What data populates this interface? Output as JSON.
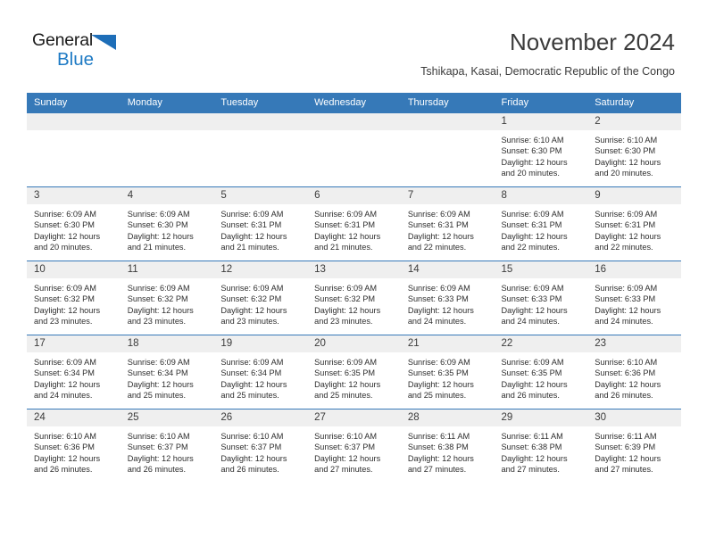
{
  "brand": {
    "name_top": "General",
    "name_bottom": "Blue",
    "accent_color": "#1e7ac4",
    "triangle_color": "#1e6eb8"
  },
  "header": {
    "title": "November 2024",
    "location": "Tshikapa, Kasai, Democratic Republic of the Congo"
  },
  "calendar": {
    "header_bg": "#3679b8",
    "daynum_bg": "#efefef",
    "weekdays": [
      "Sunday",
      "Monday",
      "Tuesday",
      "Wednesday",
      "Thursday",
      "Friday",
      "Saturday"
    ],
    "weeks": [
      [
        {
          "day": "",
          "lines": []
        },
        {
          "day": "",
          "lines": []
        },
        {
          "day": "",
          "lines": []
        },
        {
          "day": "",
          "lines": []
        },
        {
          "day": "",
          "lines": []
        },
        {
          "day": "1",
          "lines": [
            "Sunrise: 6:10 AM",
            "Sunset: 6:30 PM",
            "Daylight: 12 hours and 20 minutes."
          ]
        },
        {
          "day": "2",
          "lines": [
            "Sunrise: 6:10 AM",
            "Sunset: 6:30 PM",
            "Daylight: 12 hours and 20 minutes."
          ]
        }
      ],
      [
        {
          "day": "3",
          "lines": [
            "Sunrise: 6:09 AM",
            "Sunset: 6:30 PM",
            "Daylight: 12 hours and 20 minutes."
          ]
        },
        {
          "day": "4",
          "lines": [
            "Sunrise: 6:09 AM",
            "Sunset: 6:30 PM",
            "Daylight: 12 hours and 21 minutes."
          ]
        },
        {
          "day": "5",
          "lines": [
            "Sunrise: 6:09 AM",
            "Sunset: 6:31 PM",
            "Daylight: 12 hours and 21 minutes."
          ]
        },
        {
          "day": "6",
          "lines": [
            "Sunrise: 6:09 AM",
            "Sunset: 6:31 PM",
            "Daylight: 12 hours and 21 minutes."
          ]
        },
        {
          "day": "7",
          "lines": [
            "Sunrise: 6:09 AM",
            "Sunset: 6:31 PM",
            "Daylight: 12 hours and 22 minutes."
          ]
        },
        {
          "day": "8",
          "lines": [
            "Sunrise: 6:09 AM",
            "Sunset: 6:31 PM",
            "Daylight: 12 hours and 22 minutes."
          ]
        },
        {
          "day": "9",
          "lines": [
            "Sunrise: 6:09 AM",
            "Sunset: 6:31 PM",
            "Daylight: 12 hours and 22 minutes."
          ]
        }
      ],
      [
        {
          "day": "10",
          "lines": [
            "Sunrise: 6:09 AM",
            "Sunset: 6:32 PM",
            "Daylight: 12 hours and 23 minutes."
          ]
        },
        {
          "day": "11",
          "lines": [
            "Sunrise: 6:09 AM",
            "Sunset: 6:32 PM",
            "Daylight: 12 hours and 23 minutes."
          ]
        },
        {
          "day": "12",
          "lines": [
            "Sunrise: 6:09 AM",
            "Sunset: 6:32 PM",
            "Daylight: 12 hours and 23 minutes."
          ]
        },
        {
          "day": "13",
          "lines": [
            "Sunrise: 6:09 AM",
            "Sunset: 6:32 PM",
            "Daylight: 12 hours and 23 minutes."
          ]
        },
        {
          "day": "14",
          "lines": [
            "Sunrise: 6:09 AM",
            "Sunset: 6:33 PM",
            "Daylight: 12 hours and 24 minutes."
          ]
        },
        {
          "day": "15",
          "lines": [
            "Sunrise: 6:09 AM",
            "Sunset: 6:33 PM",
            "Daylight: 12 hours and 24 minutes."
          ]
        },
        {
          "day": "16",
          "lines": [
            "Sunrise: 6:09 AM",
            "Sunset: 6:33 PM",
            "Daylight: 12 hours and 24 minutes."
          ]
        }
      ],
      [
        {
          "day": "17",
          "lines": [
            "Sunrise: 6:09 AM",
            "Sunset: 6:34 PM",
            "Daylight: 12 hours and 24 minutes."
          ]
        },
        {
          "day": "18",
          "lines": [
            "Sunrise: 6:09 AM",
            "Sunset: 6:34 PM",
            "Daylight: 12 hours and 25 minutes."
          ]
        },
        {
          "day": "19",
          "lines": [
            "Sunrise: 6:09 AM",
            "Sunset: 6:34 PM",
            "Daylight: 12 hours and 25 minutes."
          ]
        },
        {
          "day": "20",
          "lines": [
            "Sunrise: 6:09 AM",
            "Sunset: 6:35 PM",
            "Daylight: 12 hours and 25 minutes."
          ]
        },
        {
          "day": "21",
          "lines": [
            "Sunrise: 6:09 AM",
            "Sunset: 6:35 PM",
            "Daylight: 12 hours and 25 minutes."
          ]
        },
        {
          "day": "22",
          "lines": [
            "Sunrise: 6:09 AM",
            "Sunset: 6:35 PM",
            "Daylight: 12 hours and 26 minutes."
          ]
        },
        {
          "day": "23",
          "lines": [
            "Sunrise: 6:10 AM",
            "Sunset: 6:36 PM",
            "Daylight: 12 hours and 26 minutes."
          ]
        }
      ],
      [
        {
          "day": "24",
          "lines": [
            "Sunrise: 6:10 AM",
            "Sunset: 6:36 PM",
            "Daylight: 12 hours and 26 minutes."
          ]
        },
        {
          "day": "25",
          "lines": [
            "Sunrise: 6:10 AM",
            "Sunset: 6:37 PM",
            "Daylight: 12 hours and 26 minutes."
          ]
        },
        {
          "day": "26",
          "lines": [
            "Sunrise: 6:10 AM",
            "Sunset: 6:37 PM",
            "Daylight: 12 hours and 26 minutes."
          ]
        },
        {
          "day": "27",
          "lines": [
            "Sunrise: 6:10 AM",
            "Sunset: 6:37 PM",
            "Daylight: 12 hours and 27 minutes."
          ]
        },
        {
          "day": "28",
          "lines": [
            "Sunrise: 6:11 AM",
            "Sunset: 6:38 PM",
            "Daylight: 12 hours and 27 minutes."
          ]
        },
        {
          "day": "29",
          "lines": [
            "Sunrise: 6:11 AM",
            "Sunset: 6:38 PM",
            "Daylight: 12 hours and 27 minutes."
          ]
        },
        {
          "day": "30",
          "lines": [
            "Sunrise: 6:11 AM",
            "Sunset: 6:39 PM",
            "Daylight: 12 hours and 27 minutes."
          ]
        }
      ]
    ]
  }
}
